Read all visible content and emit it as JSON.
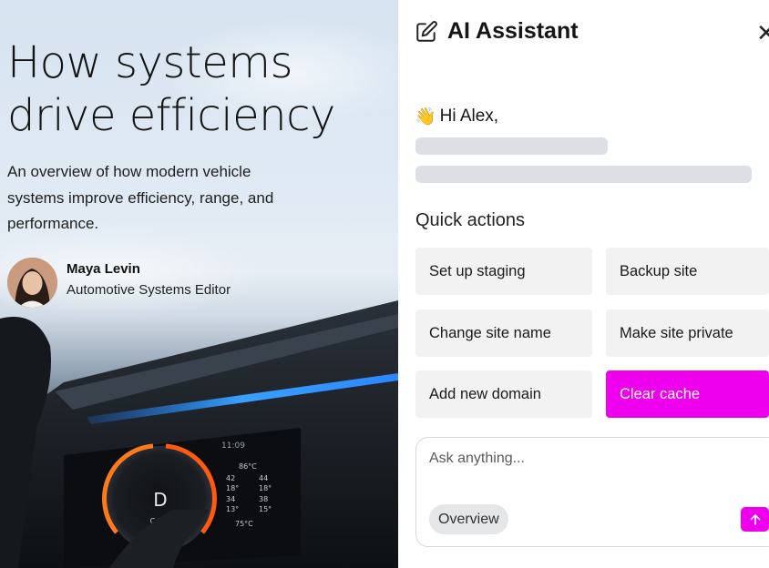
{
  "hero": {
    "title": "How systems drive efficiency",
    "subtitle": "An overview of how modern vehicle systems improve efficiency, range, and performance.",
    "author_name": "Maya Levin",
    "author_role": "Automotive Systems Editor",
    "dashboard": {
      "clock": "11:09",
      "gear": "D",
      "temp_top": "86°C",
      "temp_bottom": "75°C",
      "gear_strip": "C N D",
      "values_left": [
        "42",
        "18°",
        "34",
        "13°"
      ],
      "values_right": [
        "44",
        "18°",
        "38",
        "15°"
      ]
    }
  },
  "assistant": {
    "title": "AI Assistant",
    "edit_icon": "edit-icon",
    "close_glyph": "✕",
    "greeting_emoji": "👋",
    "greeting": "Hi Alex,",
    "quick_actions_title": "Quick actions",
    "quick_actions": [
      {
        "label": "Set up staging"
      },
      {
        "label": "Backup site"
      },
      {
        "label": "Change site name"
      },
      {
        "label": "Make site private"
      },
      {
        "label": "Add new domain"
      },
      {
        "label": "Clear cache"
      }
    ],
    "input_placeholder": "Ask anything...",
    "chip_label": "Overview",
    "accent_color": "#ee00ee"
  }
}
